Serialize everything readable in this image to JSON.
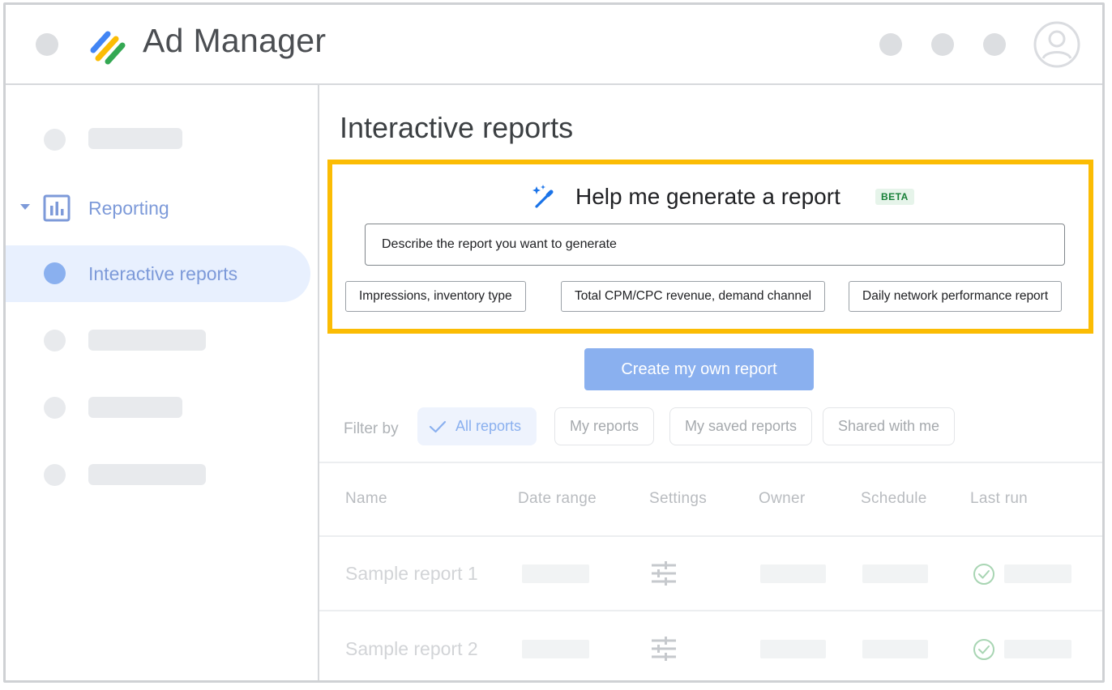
{
  "app": {
    "title": "Ad Manager",
    "logo_icon": "ad-manager-logo",
    "brand_colors": [
      "#4285f4",
      "#fbbc04",
      "#34a853"
    ]
  },
  "sidebar": {
    "section": {
      "label": "Reporting",
      "icon": "bar-chart-icon",
      "expanded": true
    },
    "active_item": {
      "label": "Interactive reports"
    },
    "accent_color": "#7d9ad9"
  },
  "main": {
    "title": "Interactive reports",
    "generator": {
      "title": "Help me generate a report",
      "badge": "BETA",
      "icon": "magic-wand-icon",
      "input_value": "Describe the report you want to generate",
      "suggestions": [
        "Impressions, inventory type",
        "Total CPM/CPC revenue, demand channel",
        "Daily network performance report"
      ],
      "highlight_color": "#fbbc04"
    },
    "create_button": "Create my own report",
    "filter": {
      "label": "Filter by",
      "options": [
        "All reports",
        "My reports",
        "My saved reports",
        "Shared with me"
      ],
      "selected": "All reports"
    },
    "table": {
      "columns": [
        "Name",
        "Date range",
        "Settings",
        "Owner",
        "Schedule",
        "Last run"
      ],
      "rows": [
        {
          "name": "Sample report 1",
          "settings_icon": "tune-icon",
          "status_icon": "check-circle-icon"
        },
        {
          "name": "Sample report 2",
          "settings_icon": "tune-icon",
          "status_icon": "check-circle-icon"
        }
      ]
    }
  }
}
